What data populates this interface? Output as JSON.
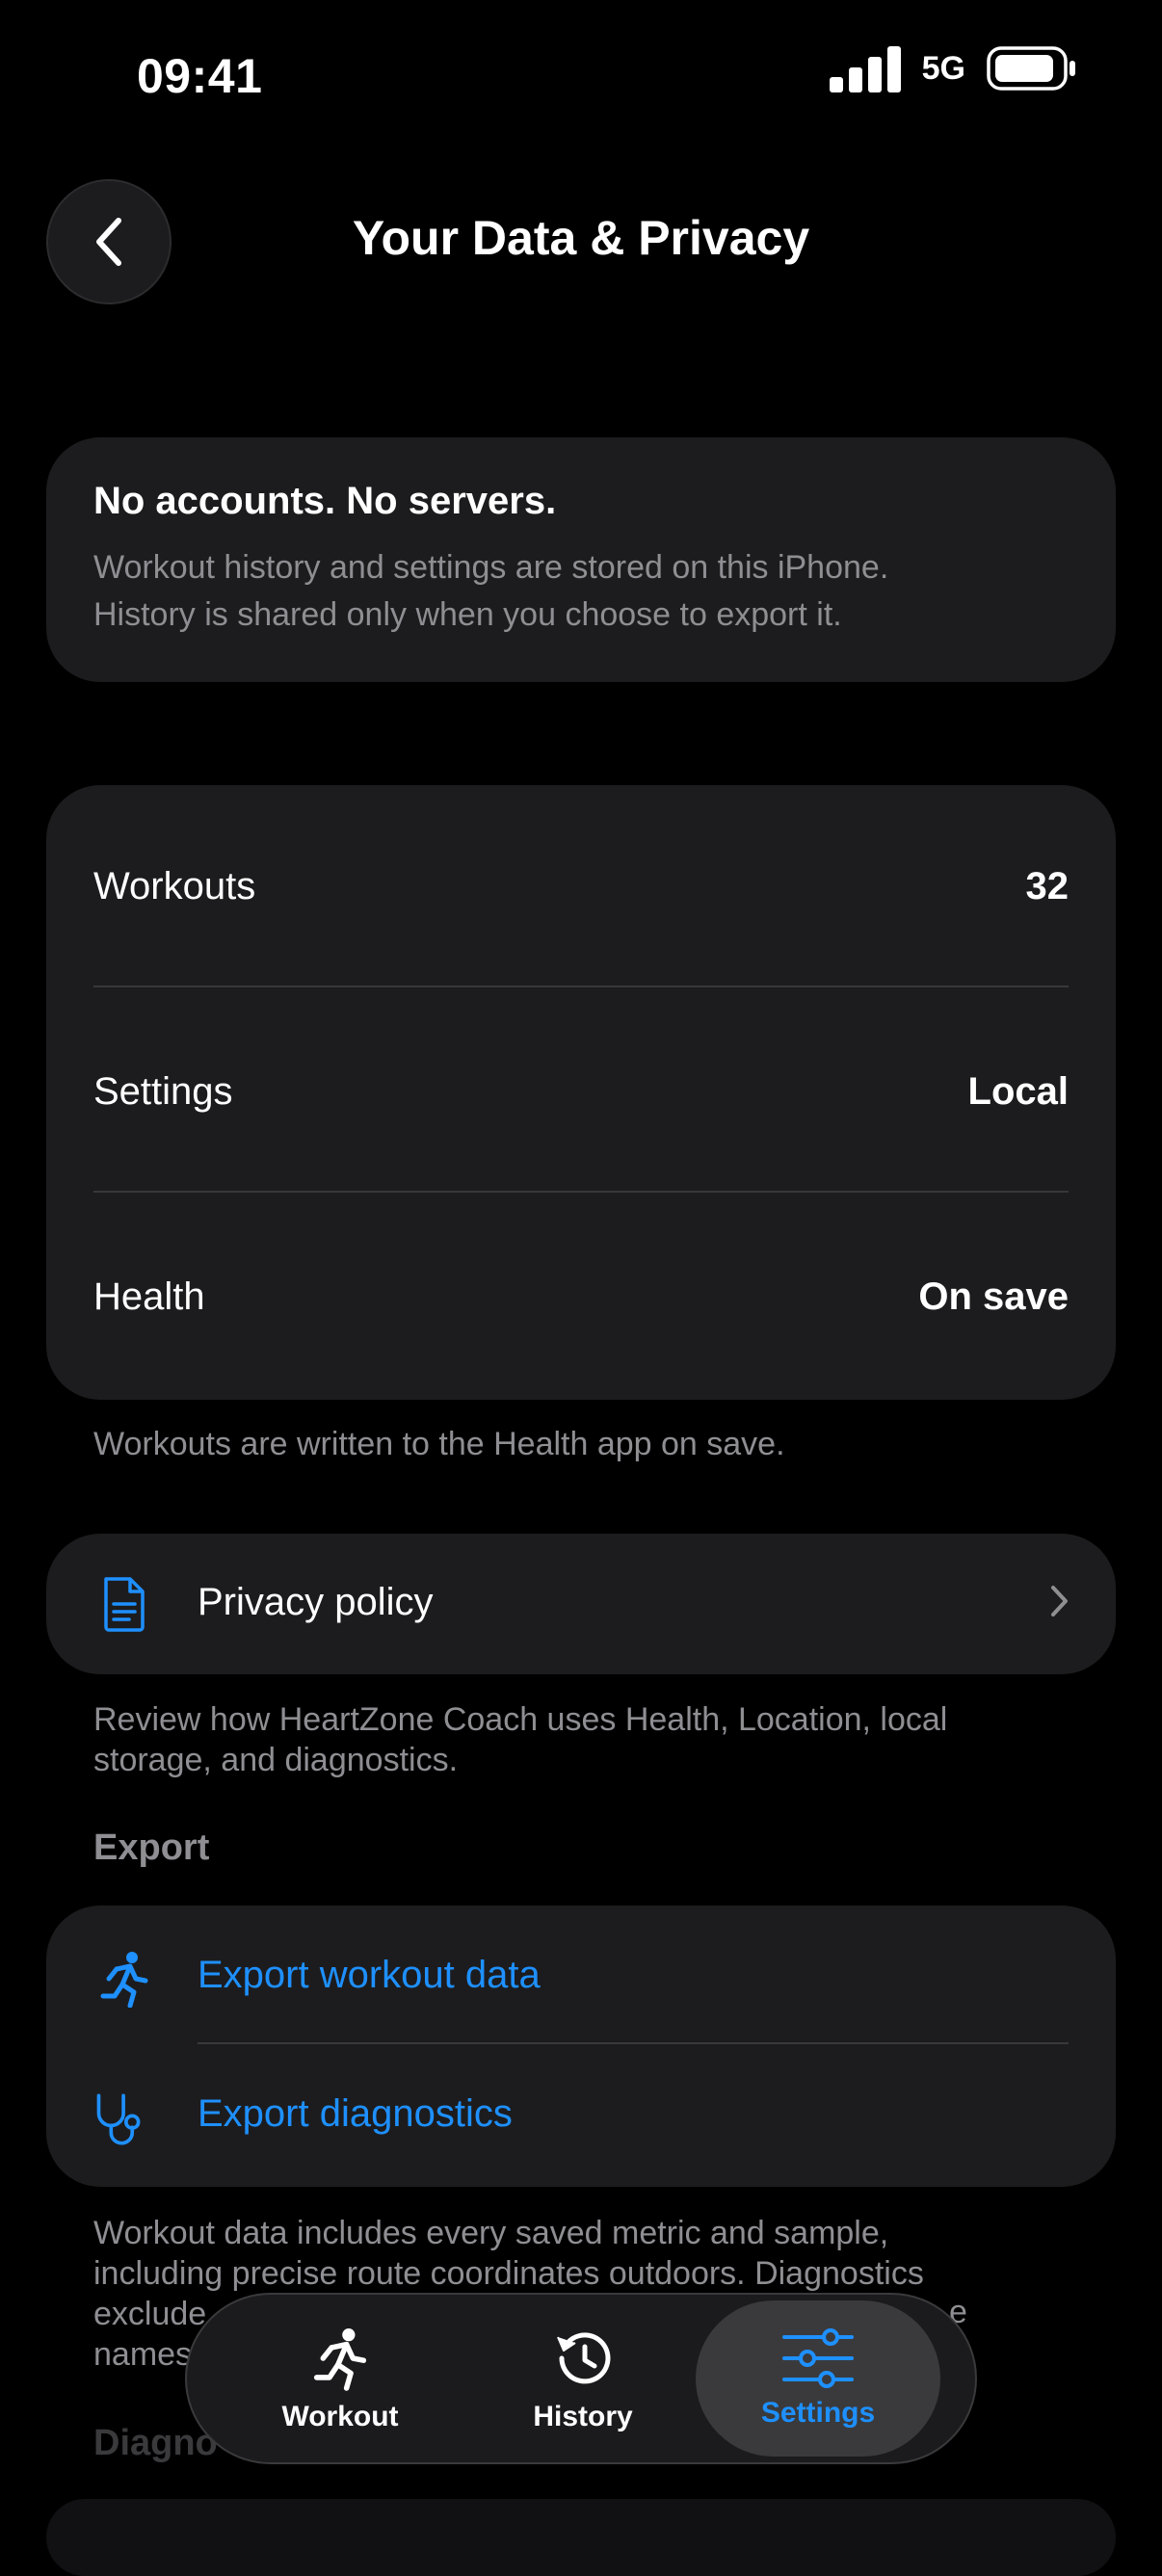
{
  "status_bar": {
    "time": "09:41",
    "network": "5G"
  },
  "header": {
    "title": "Your Data & Privacy"
  },
  "info_card": {
    "title": "No accounts. No servers.",
    "body_line1": "Workout history and settings are stored on this iPhone.",
    "body_line2": "History is shared only when you choose to export it."
  },
  "stats": [
    {
      "label": "Workouts",
      "value": "32"
    },
    {
      "label": "Settings",
      "value": "Local"
    },
    {
      "label": "Health",
      "value": "On save"
    }
  ],
  "health_note": "Workouts are written to the Health app on save.",
  "privacy": {
    "label": "Privacy policy",
    "note_line1": "Review how HeartZone Coach uses Health, Location, local",
    "note_line2": "storage, and diagnostics."
  },
  "export": {
    "header": "Export",
    "workout_label": "Export workout data",
    "diagnostics_label": "Export diagnostics",
    "note_line1": "Workout data includes every saved metric and sample,",
    "note_line2": "including precise route coordinates outdoors. Diagnostics",
    "note_line3": "exclude",
    "note_line3_end": "e",
    "note_line4": "names"
  },
  "diagnostics_header": "Diagno",
  "tabs": [
    {
      "label": "Workout",
      "icon": "runner-icon",
      "active": false
    },
    {
      "label": "History",
      "icon": "history-icon",
      "active": false
    },
    {
      "label": "Settings",
      "icon": "sliders-icon",
      "active": true
    }
  ],
  "colors": {
    "accent": "#1e90ff",
    "background": "#000000",
    "card": "#1c1c1e",
    "secondary_text": "#8e8e93"
  }
}
